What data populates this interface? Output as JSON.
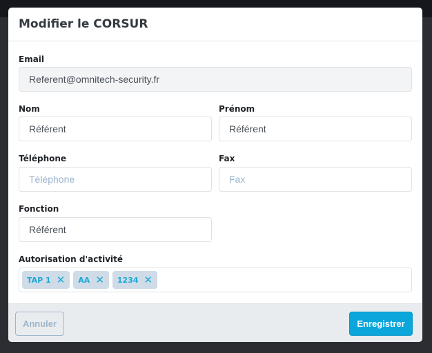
{
  "modal": {
    "title": "Modifier le CORSUR"
  },
  "fields": {
    "email": {
      "label": "Email",
      "value": "Referent@omnitech-security.fr"
    },
    "nom": {
      "label": "Nom",
      "value": "Référent"
    },
    "prenom": {
      "label": "Prénom",
      "value": "Référent"
    },
    "telephone": {
      "label": "Téléphone",
      "placeholder": "Téléphone"
    },
    "fax": {
      "label": "Fax",
      "placeholder": "Fax"
    },
    "fonction": {
      "label": "Fonction",
      "value": "Référent"
    },
    "autorisation": {
      "label": "Autorisation d'activité",
      "tags": [
        "TAP 1",
        "AA",
        "1234"
      ]
    }
  },
  "footer": {
    "cancel": "Annuler",
    "save": "Enregistrer"
  },
  "colors": {
    "primary": "#0aa6dc",
    "tag_bg": "#cfdce8",
    "tag_text": "#1fa7d6"
  }
}
